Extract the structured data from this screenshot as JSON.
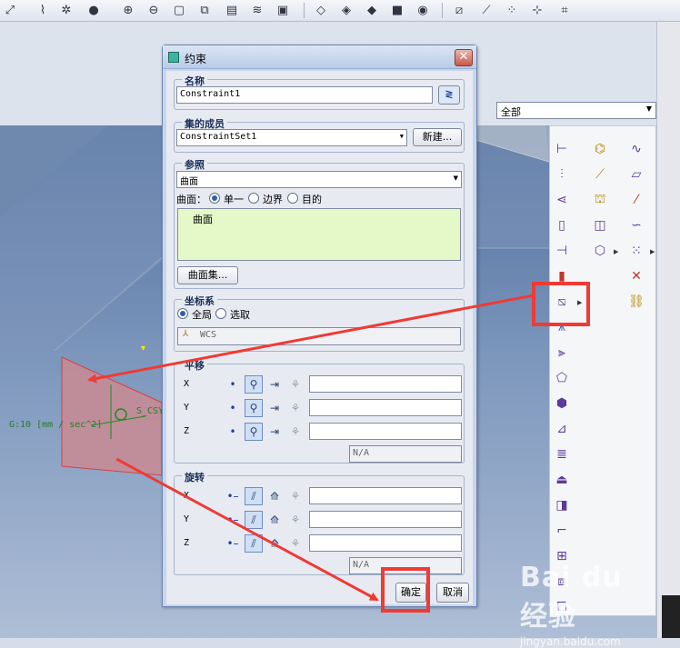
{
  "toolbar": {
    "icons": [
      "zoom-fit-icon",
      "spline-icon",
      "network-icon",
      "shading-ball-icon",
      "zoom-in-icon",
      "zoom-out-icon",
      "refit-icon",
      "view-manager-icon",
      "saved-views-icon",
      "layers-icon",
      "model-display-icon",
      "wireframe-icon",
      "hidden-line-icon",
      "no-hidden-icon",
      "shaded-icon",
      "spin-center-icon",
      "datum-plane-display-icon",
      "datum-axis-display-icon",
      "datum-point-display-icon",
      "csys-display-icon",
      "annotation-display-icon"
    ]
  },
  "filter": {
    "value": "全部"
  },
  "dialog": {
    "title": "约束",
    "close": "✕",
    "name_group": {
      "title": "名称",
      "value": "Constraint1"
    },
    "set_group": {
      "title": "集的成员",
      "value": "ConstraintSet1",
      "new_button": "新建..."
    },
    "ref_group": {
      "title": "参照",
      "type_value": "曲面",
      "mode_label": "曲面：",
      "options": [
        "单一",
        "边界",
        "目的"
      ],
      "selected_option": "单一",
      "list_items": [
        "曲面"
      ],
      "surface_set_button": "曲面集..."
    },
    "csys_group": {
      "title": "坐标系",
      "options": [
        "全局",
        "选取"
      ],
      "selected_option": "全局",
      "csys_value": "WCS"
    },
    "translation_group": {
      "title": "平移",
      "axes": [
        "X",
        "Y",
        "Z"
      ],
      "summary": "N/A"
    },
    "rotation_group": {
      "title": "旋转",
      "axes": [
        "X",
        "Y",
        "Z"
      ],
      "summary": "N/A"
    },
    "ok_button": "确定",
    "cancel_button": "取消"
  },
  "viewport": {
    "gravity_label": "G:10 [mm / sec^2]",
    "csys_label": "S_CSYS",
    "marker": "Y"
  },
  "watermark": {
    "logo": "Bai du 经验",
    "url": "jingyan.baidu.com"
  },
  "colors": {
    "annotation_red": "#ee3b35",
    "surface_fill": "#c98b93",
    "list_green": "#e4f8c8"
  }
}
